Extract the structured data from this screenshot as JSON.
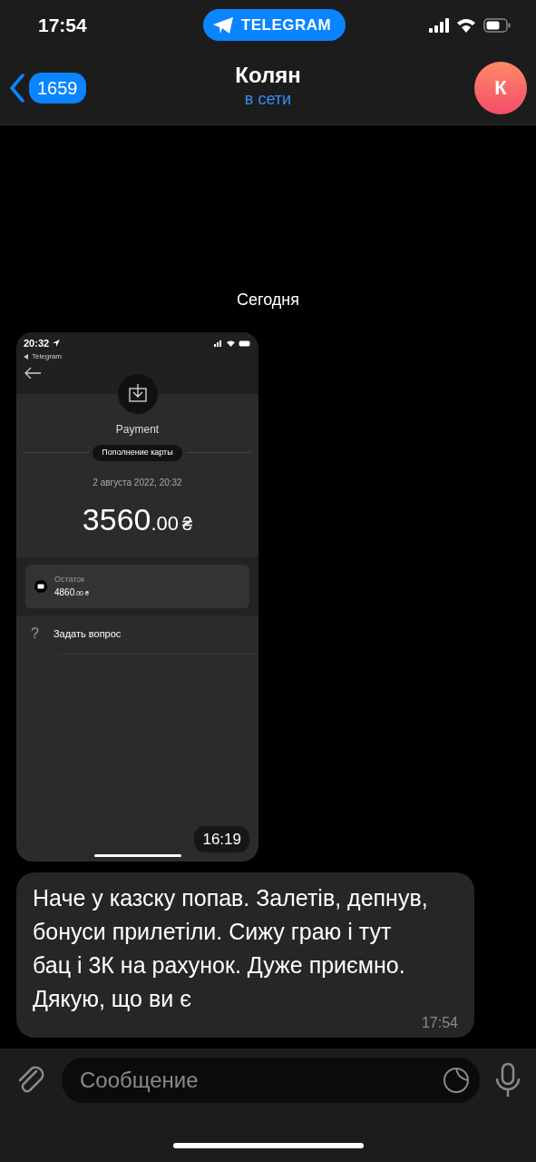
{
  "status_bar": {
    "time": "17:54",
    "app_pill": "TELEGRAM"
  },
  "header": {
    "back_count": "1659",
    "title": "Колян",
    "status": "в сети",
    "avatar_letter": "К"
  },
  "date_separator": "Сегодня",
  "messages": [
    {
      "kind": "photo",
      "time": "16:19",
      "screenshot": {
        "time": "20:32",
        "back_app": "Telegram",
        "title": "Payment",
        "tag": "Пополнение карты",
        "date": "2 августа 2022, 20:32",
        "amount": "3560",
        "amount_fraction": ".00",
        "currency": "₴",
        "balance_label": "Остаток",
        "balance": "4860",
        "balance_fraction": ".00 ₴",
        "question_mark": "?",
        "question": "Задать вопрос"
      }
    },
    {
      "kind": "text",
      "text": "Наче у казску попав. Залетів, депнув, бонуси прилетіли. Сижу граю і тут бац і 3К на рахунок. Дуже приємно. Дякую, що ви є",
      "time": "17:54"
    }
  ],
  "input": {
    "placeholder": "Сообщение"
  }
}
